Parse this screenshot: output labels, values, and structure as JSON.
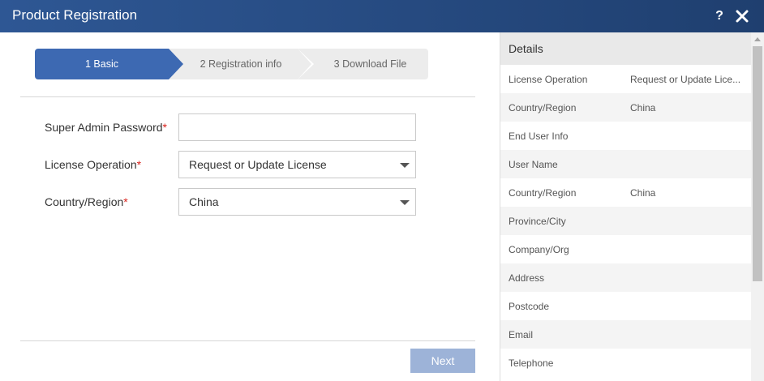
{
  "window": {
    "title": "Product Registration",
    "help_label": "?",
    "close_icon": "close-icon"
  },
  "steps": [
    {
      "label": "1 Basic",
      "active": true
    },
    {
      "label": "2 Registration info",
      "active": false
    },
    {
      "label": "3 Download File",
      "active": false
    }
  ],
  "form": {
    "password_label": "Super Admin Password",
    "password_value": "",
    "license_label": "License Operation",
    "license_value": "Request or Update License",
    "country_label": "Country/Region",
    "country_value": "China",
    "required_mark": "*"
  },
  "next_button": "Next",
  "details": {
    "header": "Details",
    "rows": [
      {
        "key": "License Operation",
        "value": "Request or Update Lice..."
      },
      {
        "key": "Country/Region",
        "value": "China"
      },
      {
        "key": "End User Info",
        "value": ""
      },
      {
        "key": "User Name",
        "value": ""
      },
      {
        "key": "Country/Region",
        "value": "China"
      },
      {
        "key": "Province/City",
        "value": ""
      },
      {
        "key": "Company/Org",
        "value": ""
      },
      {
        "key": "Address",
        "value": ""
      },
      {
        "key": "Postcode",
        "value": ""
      },
      {
        "key": "Email",
        "value": ""
      },
      {
        "key": "Telephone",
        "value": ""
      }
    ]
  },
  "colors": {
    "titlebar": "#2e5794",
    "active_step": "#3d69b2",
    "next_button": "#9db3d8",
    "required": "#d9231d"
  }
}
